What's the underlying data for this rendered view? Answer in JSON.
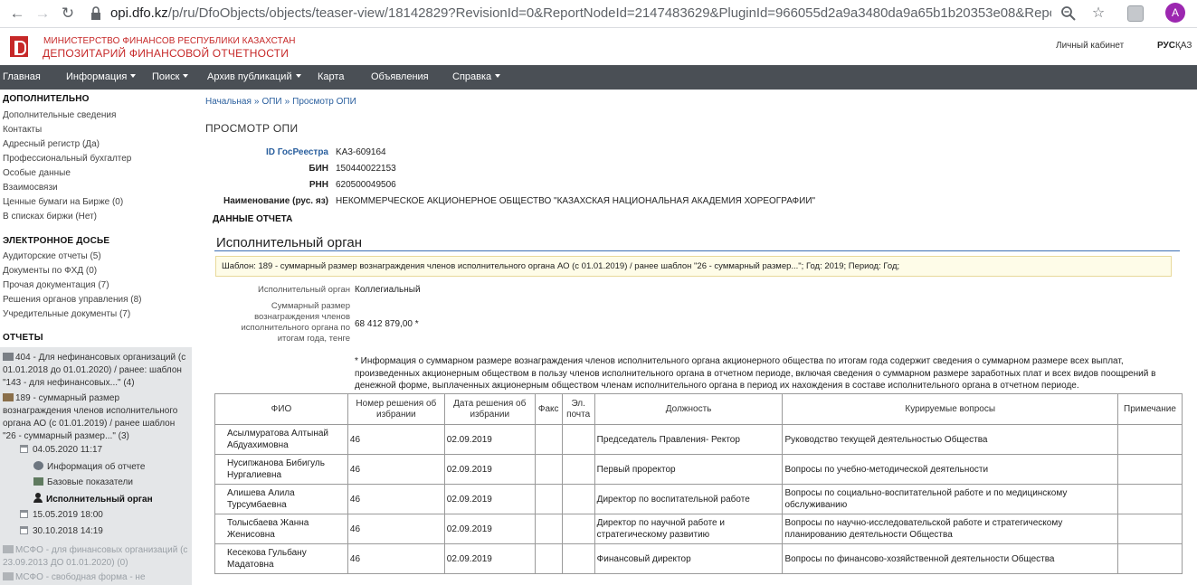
{
  "browser": {
    "url_host": "opi.dfo.kz",
    "url_path": "/p/ru/DfoObjects/objects/teaser-view/18142829?RevisionId=0&ReportNodeId=2147483629&PluginId=966055d2a9a3480da9a65b1b20353e08&ReportId=...",
    "profile_initial": "A"
  },
  "header": {
    "ministry": "МИНИСТЕРСТВО ФИНАНСОВ РЕСПУБЛИКИ КАЗАХСТАН",
    "depository": "ДЕПОЗИТАРИЙ ФИНАНСОВОЙ ОТЧЕТНОСТИ",
    "cabinet": "Личный кабинет",
    "lang_ru": "РУС",
    "lang_kz": "ҚАЗ"
  },
  "nav": [
    "Главная",
    "Информация",
    "Поиск",
    "Архив публикаций",
    "Карта",
    "Объявления",
    "Справка"
  ],
  "sidebar": {
    "extra_title": "ДОПОЛНИТЕЛЬНО",
    "extra": [
      "Дополнительные сведения",
      "Контакты",
      "Адресный регистр (Да)",
      "Профессиональный бухгалтер",
      "Особые данные",
      "Взаимосвязи",
      "Ценные бумаги на Бирже (0)",
      "В списках биржи (Нет)"
    ],
    "dossier_title": "ЭЛЕКТРОННОЕ ДОСЬЕ",
    "dossier": [
      "Аудиторские отчеты (5)",
      "Документы по ФХД (0)",
      "Прочая документация (7)",
      "Решения органов управления (8)",
      "Учредительные документы (7)"
    ],
    "reports_title": "ОТЧЕТЫ",
    "report_404": "404 - Для нефинансовых организаций (с 01.01.2018 до 01.01.2020) / ранее: шаблон \"143 - для нефинансовых...\" (4)",
    "report_189": "189 - суммарный размер вознаграждения членов исполнительного органа АО (с 01.01.2019) / ранее шаблон \"26 - суммарный размер...\" (3)",
    "date_1": "04.05.2020 11:17",
    "sub_info": "Информация об отчете",
    "sub_base": "Базовые показатели",
    "sub_exec": "Исполнительный орган",
    "date_2": "15.05.2019 18:00",
    "date_3": "30.10.2018 14:19",
    "msfo_1": "МСФО - для финансовых организаций (с 23.09.2013 ДО 01.01.2020) (0)",
    "msfo_2": "МСФО - свободная форма - не"
  },
  "breadcrumb": [
    "Начальная",
    "ОПИ",
    "Просмотр ОПИ"
  ],
  "page_title": "ПРОСМОТР ОПИ",
  "company": {
    "reg_label": "ID ГосРеестра",
    "reg_value": "KA3-609164",
    "bin_label": "БИН",
    "bin_value": "150440022153",
    "rnn_label": "РНН",
    "rnn_value": "620500049506",
    "name_label": "Наименование (рус. яз)",
    "name_ru": "НЕКОММЕРЧЕСКОЕ АКЦИОНЕРНОЕ ОБЩЕСТВО \"КАЗАХСКАЯ НАЦИОНАЛЬНАЯ АКАДЕМИЯ ХОРЕОГРАФИИ\""
  },
  "report_data_label": "ДАННЫЕ ОТЧЕТА",
  "section": {
    "title": "Исполнительный орган",
    "template": "Шаблон: 189 - суммарный размер вознаграждения членов исполнительного органа АО (с 01.01.2019) / ранее шаблон \"26 - суммарный размер...\"; Год: 2019; Период: Год;",
    "exec_label": "Исполнительный орган",
    "exec_value": "Коллегиальный",
    "total_label": "Суммарный размер вознаграждения членов исполнительного органа по итогам года, тенге",
    "total_value": "68 412 879,00 *",
    "note": "* Информация о суммарном размере вознаграждения членов исполнительного органа акционерного общества по итогам года содержит сведения о суммарном размере всех выплат, произведенных акционерным обществом в пользу членов исполнительного органа в отчетном периоде, включая сведения о суммарном размере заработных плат и всех видов поощрений в денежной форме, выплаченных акционерным обществом членам исполнительного органа в период их нахождения в составе исполнительного органа в отчетном периоде."
  },
  "chart_data": {
    "type": "table",
    "columns": [
      "ФИО",
      "Номер решения об избрании",
      "Дата решения об избрании",
      "Факс",
      "Эл. почта",
      "Должность",
      "Курируемые вопросы",
      "Примечание"
    ],
    "rows": [
      {
        "name": "Асылмуратова Алтынай Абдуахимовна",
        "decision": "46",
        "date": "02.09.2019",
        "fax": "",
        "email": "",
        "position": "Председатель Правления- Ректор",
        "area": "Руководство текущей деятельностью Общества",
        "note": ""
      },
      {
        "name": "Нусипжанова Бибигуль Нургалиевна",
        "decision": "46",
        "date": "02.09.2019",
        "fax": "",
        "email": "",
        "position": "Первый проректор",
        "area": "Вопросы по учебно-методической деятельности",
        "note": ""
      },
      {
        "name": "Алишева Алила Турсумбаевна",
        "decision": "46",
        "date": "02.09.2019",
        "fax": "",
        "email": "",
        "position": "Директор по воспитательной работе",
        "area": "Вопросы по социально-воспитательной работе и по медицинскому обслуживанию",
        "note": ""
      },
      {
        "name": "Толысбаева Жанна Женисовна",
        "decision": "46",
        "date": "02.09.2019",
        "fax": "",
        "email": "",
        "position": "Директор по научной работе и стратегическому развитию",
        "area": "Вопросы по научно-исследовательской работе и стратегическому планированию деятельности Общества",
        "note": ""
      },
      {
        "name": "Кесекова Гульбану Мадатовна",
        "decision": "46",
        "date": "02.09.2019",
        "fax": "",
        "email": "",
        "position": "Финансовый директор",
        "area": "Вопросы по финансово-хозяйственной деятельности Общества",
        "note": ""
      }
    ]
  }
}
